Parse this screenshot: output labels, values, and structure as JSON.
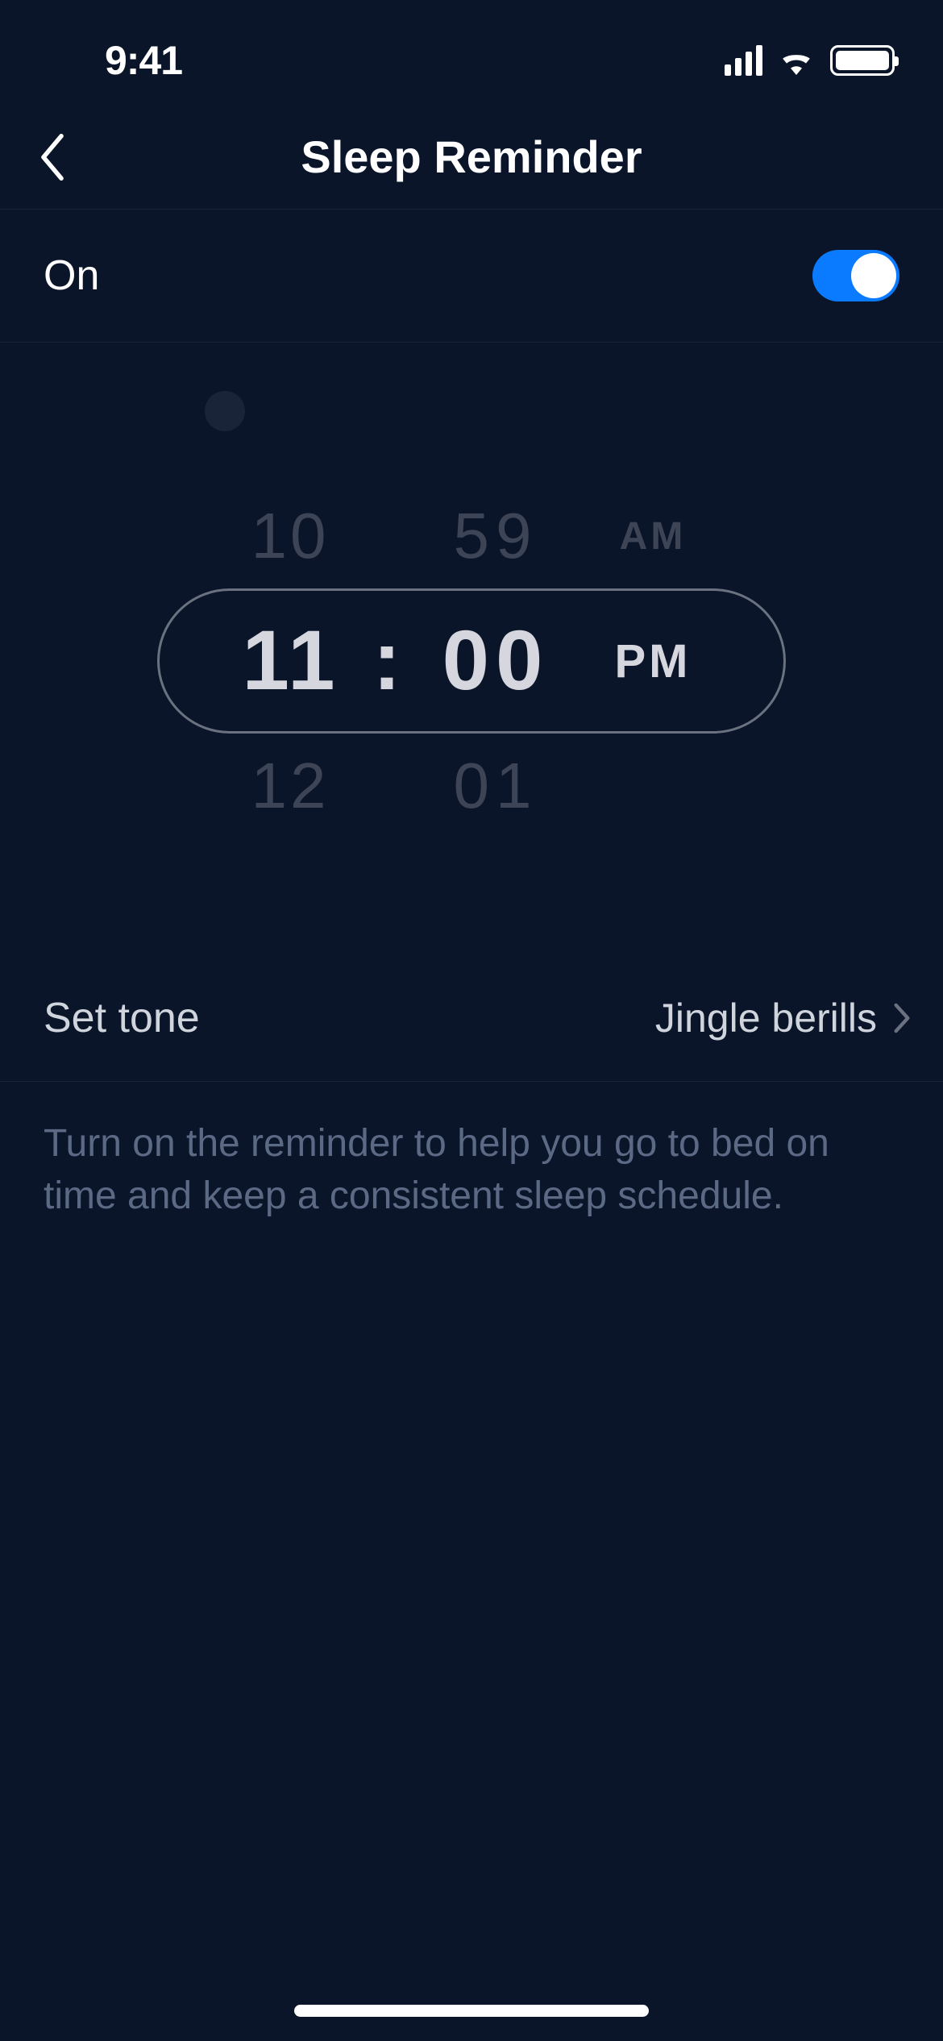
{
  "status": {
    "time": "9:41"
  },
  "header": {
    "title": "Sleep Reminder"
  },
  "toggle": {
    "label": "On",
    "state": true
  },
  "picker": {
    "prev": {
      "hour": "10",
      "minute": "59",
      "meridiem": "AM"
    },
    "selected": {
      "hour": "11",
      "separator": ":",
      "minute": "00",
      "meridiem": "PM"
    },
    "next": {
      "hour": "12",
      "minute": "01",
      "meridiem": ""
    }
  },
  "tone": {
    "label": "Set tone",
    "value": "Jingle berills"
  },
  "description": "Turn on the reminder to help you go to bed on time and keep a consistent sleep schedule."
}
